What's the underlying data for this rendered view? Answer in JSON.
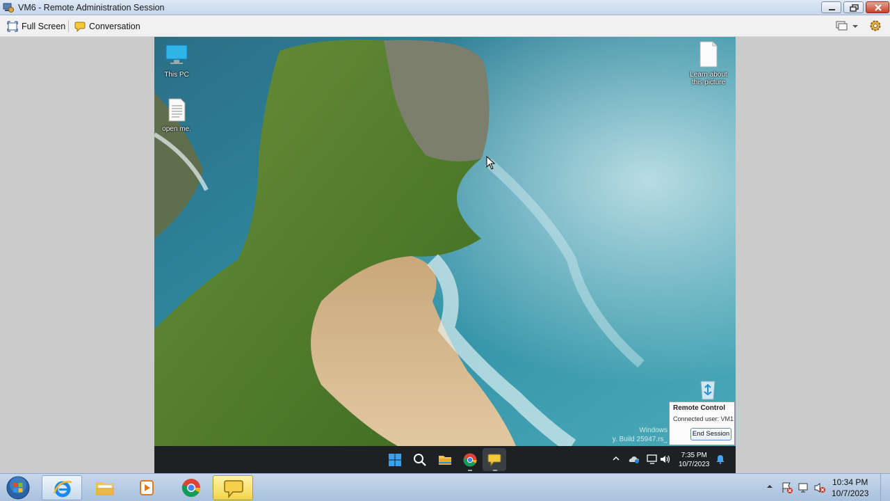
{
  "window": {
    "title": "VM6 - Remote Administration Session",
    "app_icon": "remote-admin-icon",
    "buttons": [
      "minimize-icon",
      "restore-icon",
      "close-icon"
    ]
  },
  "toolbar": {
    "full_screen_label": "Full Screen",
    "conversation_label": "Conversation",
    "right_icons": [
      "display-icon",
      "chevron-down-icon",
      "settings-gear-icon"
    ]
  },
  "remote_desktop": {
    "icons": [
      {
        "label": "This PC",
        "icon": "monitor-icon"
      },
      {
        "label": "open me.",
        "icon": "text-document-icon"
      },
      {
        "label": "Learn about this picture",
        "icon": "blank-document-icon"
      },
      {
        "label": "",
        "icon": "recycle-bin-icon"
      }
    ],
    "watermark": {
      "line1": "Windows",
      "line2": "y. Build 25947.rs_"
    },
    "taskbar": {
      "apps": [
        "windows-start-icon",
        "search-icon",
        "file-explorer-icon",
        "chrome-icon",
        "chat-bubble-icon"
      ],
      "tray_icons": [
        "chevron-up-icon",
        "onedrive-icon",
        "network-icon",
        "speaker-icon"
      ],
      "time": "7:35 PM",
      "date": "10/7/2023",
      "notification_icon": "bell-icon"
    },
    "remote_control_popup": {
      "title": "Remote Control",
      "connected_user": "Connected user: VM1",
      "end_session_label": "End Session"
    }
  },
  "host_taskbar": {
    "start": "windows7-start-orb-icon",
    "apps": [
      "internet-explorer-icon",
      "file-explorer-icon",
      "media-player-icon",
      "chrome-icon",
      "chat-bubble-icon"
    ],
    "tray_icons": [
      "chevron-up-icon",
      "action-center-icon",
      "network-icon",
      "speaker-muted-icon"
    ],
    "time": "10:34 PM",
    "date": "10/7/2023"
  }
}
